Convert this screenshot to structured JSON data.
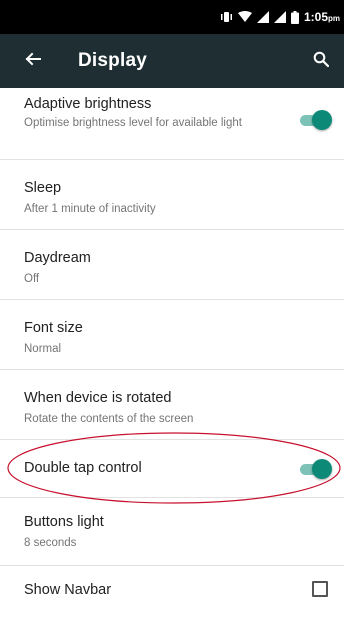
{
  "status_bar": {
    "time": "1:05",
    "time_suffix": "pm"
  },
  "app_bar": {
    "title": "Display"
  },
  "settings": [
    {
      "title": "Adaptive brightness",
      "summary": "Optimise brightness level for available light",
      "control": "toggle",
      "checked": true
    },
    {
      "title": "Sleep",
      "summary": "After 1 minute of inactivity",
      "control": "none"
    },
    {
      "title": "Daydream",
      "summary": "Off",
      "control": "none"
    },
    {
      "title": "Font size",
      "summary": "Normal",
      "control": "none"
    },
    {
      "title": "When device is rotated",
      "summary": "Rotate the contents of the screen",
      "control": "none"
    },
    {
      "title": "Double tap control",
      "summary": "",
      "control": "toggle",
      "checked": true
    },
    {
      "title": "Buttons light",
      "summary": "8 seconds",
      "control": "none"
    },
    {
      "title": "Show Navbar",
      "summary": "",
      "control": "checkbox",
      "checked": false
    }
  ],
  "colors": {
    "status_bar": "#000000",
    "app_bar": "#1f2e33",
    "accent": "#0d8a77",
    "annotation": "#c8102e"
  },
  "icons": {
    "back": "arrow-back-icon",
    "search": "search-icon",
    "vibrate": "vibrate-icon",
    "wifi": "wifi-icon",
    "signal": "signal-icon",
    "battery": "battery-icon"
  }
}
